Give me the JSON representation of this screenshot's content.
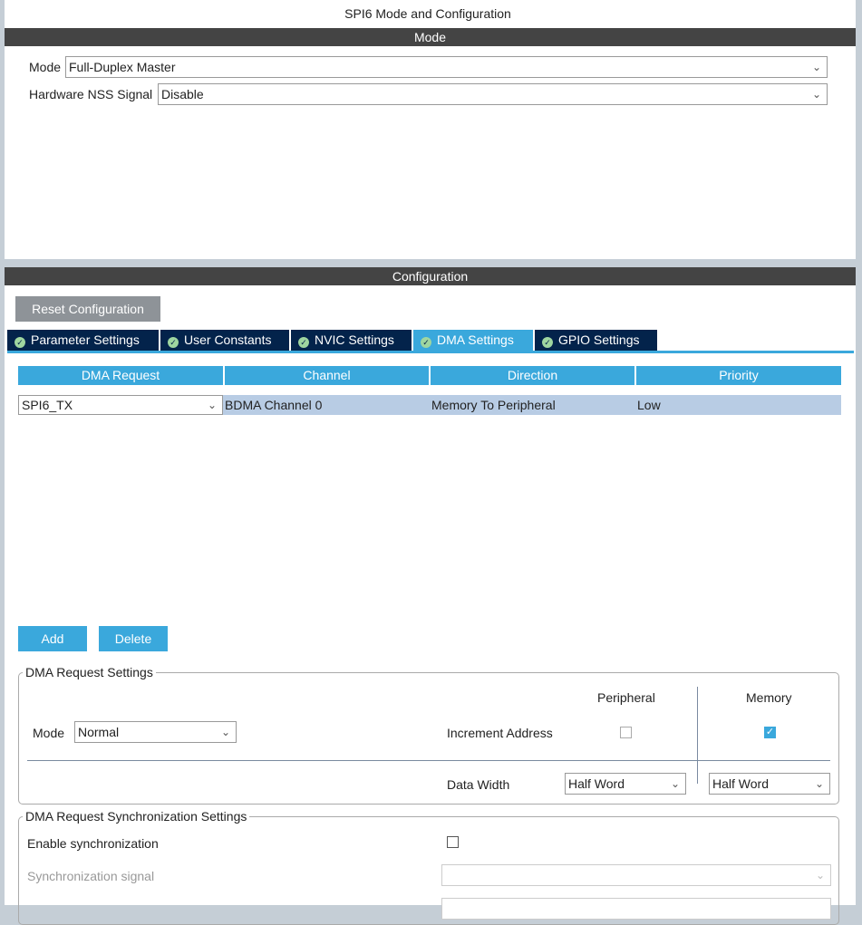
{
  "title": "SPI6 Mode and Configuration",
  "mode_header": "Mode",
  "mode": {
    "mode_label": "Mode",
    "mode_value": "Full-Duplex Master",
    "nss_label": "Hardware NSS Signal",
    "nss_value": "Disable"
  },
  "config_header": "Configuration",
  "reset_button": "Reset Configuration",
  "tabs": [
    {
      "label": "Parameter Settings"
    },
    {
      "label": "User Constants"
    },
    {
      "label": "NVIC Settings"
    },
    {
      "label": "DMA Settings"
    },
    {
      "label": "GPIO Settings"
    }
  ],
  "table": {
    "headers": [
      "DMA Request",
      "Channel",
      "Direction",
      "Priority"
    ],
    "rows": [
      {
        "request": "SPI6_TX",
        "channel": "BDMA Channel 0",
        "direction": "Memory To Peripheral",
        "priority": "Low"
      }
    ]
  },
  "add_button": "Add",
  "delete_button": "Delete",
  "request_settings": {
    "title": "DMA Request Settings",
    "mode_label": "Mode",
    "mode_value": "Normal",
    "peripheral": "Peripheral",
    "memory": "Memory",
    "increment_label": "Increment Address",
    "peripheral_increment": false,
    "memory_increment": true,
    "data_width_label": "Data Width",
    "peripheral_width": "Half Word",
    "memory_width": "Half Word"
  },
  "sync_settings": {
    "title": "DMA Request Synchronization Settings",
    "enable_label": "Enable synchronization",
    "enable": false,
    "signal_label": "Synchronization signal",
    "signal_value": ""
  }
}
